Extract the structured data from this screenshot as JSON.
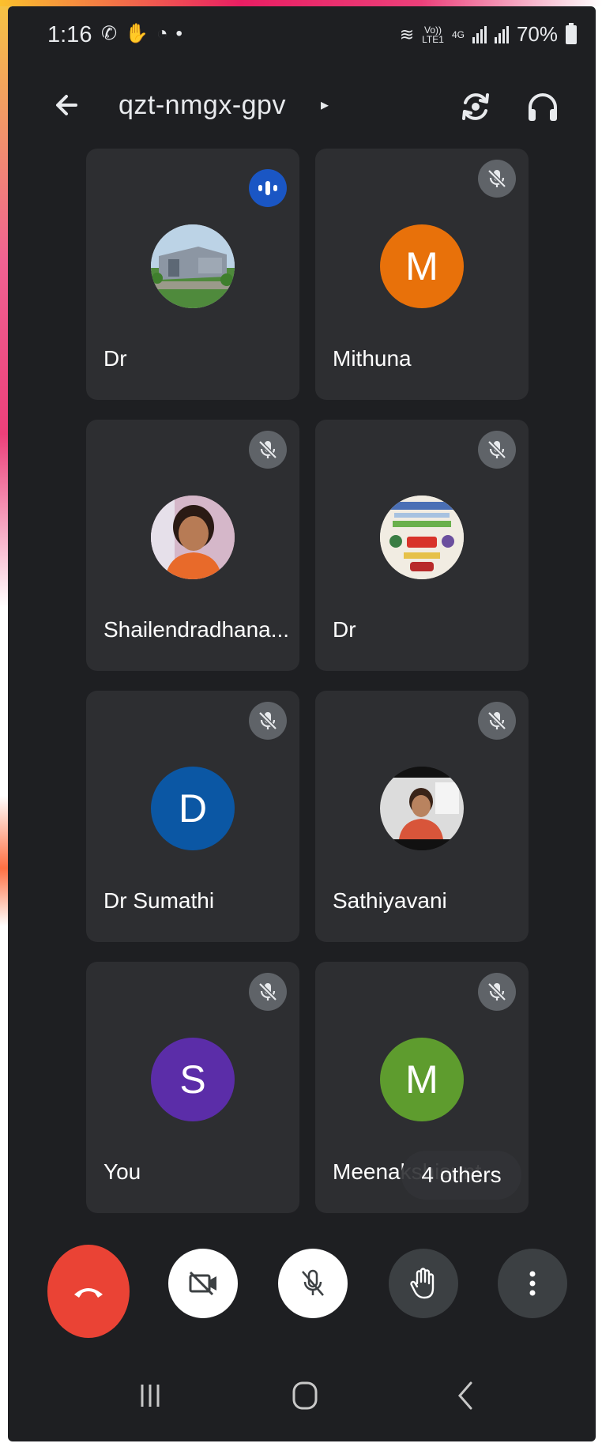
{
  "status_bar": {
    "time": "1:16",
    "left_icons": [
      "whatsapp-icon",
      "hand-icon",
      "photo-icon",
      "dot-icon"
    ],
    "network_label_top": "Vo))",
    "network_label_bottom": "LTE1",
    "network_type": "4G",
    "battery": "70%"
  },
  "app_bar": {
    "meeting_code": "qzt-nmgx-gpv",
    "caret": "▸"
  },
  "tiles": [
    {
      "name": "Dr",
      "avatar_type": "photo-building",
      "status": "speaking"
    },
    {
      "name": "Mithuna",
      "avatar_letter": "M",
      "avatar_color": "#e8710a",
      "status": "muted"
    },
    {
      "name": "Shailendradhana...",
      "avatar_type": "photo-person",
      "status": "muted"
    },
    {
      "name": "Dr",
      "avatar_type": "photo-poster",
      "status": "muted"
    },
    {
      "name": "Dr Sumathi",
      "avatar_letter": "D",
      "avatar_color": "#0b57a4",
      "status": "muted"
    },
    {
      "name": "Sathiyavani",
      "avatar_type": "photo-person",
      "status": "muted"
    },
    {
      "name": "You",
      "avatar_letter": "S",
      "avatar_color": "#5b2da8",
      "status": "muted"
    },
    {
      "name": "Meenakshisunt...",
      "avatar_letter": "M",
      "avatar_color": "#5e9c2e",
      "status": "muted"
    }
  ],
  "others_chip": "4 others",
  "controls": [
    "end-call",
    "camera-off",
    "mic-off",
    "raise-hand",
    "more-options"
  ]
}
